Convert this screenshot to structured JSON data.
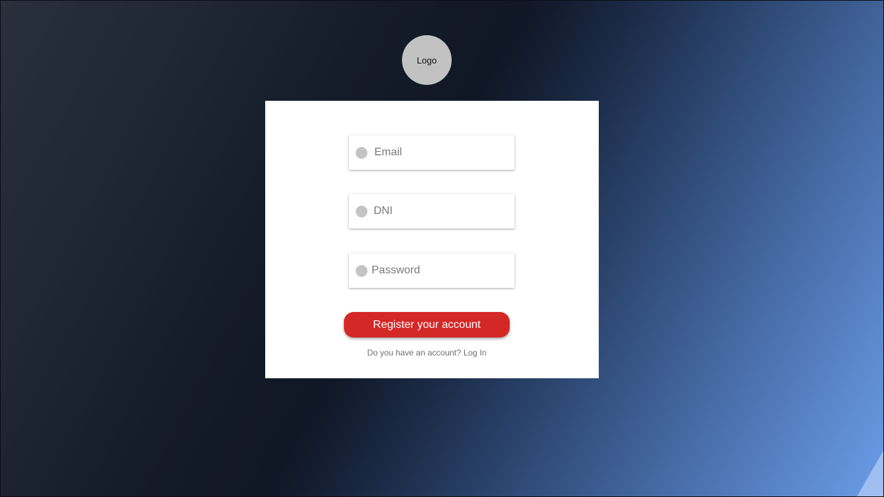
{
  "logo": {
    "text": "Logo"
  },
  "form": {
    "email": {
      "placeholder": "Email",
      "value": ""
    },
    "dni": {
      "placeholder": "DNI",
      "value": ""
    },
    "password": {
      "placeholder": "Password",
      "value": ""
    },
    "register_label": "Register your account",
    "login_prompt": "Do you have an account?",
    "login_link": "Log In"
  },
  "colors": {
    "accent": "#d42826",
    "card": "#ffffff",
    "icon_placeholder": "#c4c4c4"
  },
  "icons": {
    "field_icon": "circle-icon"
  }
}
